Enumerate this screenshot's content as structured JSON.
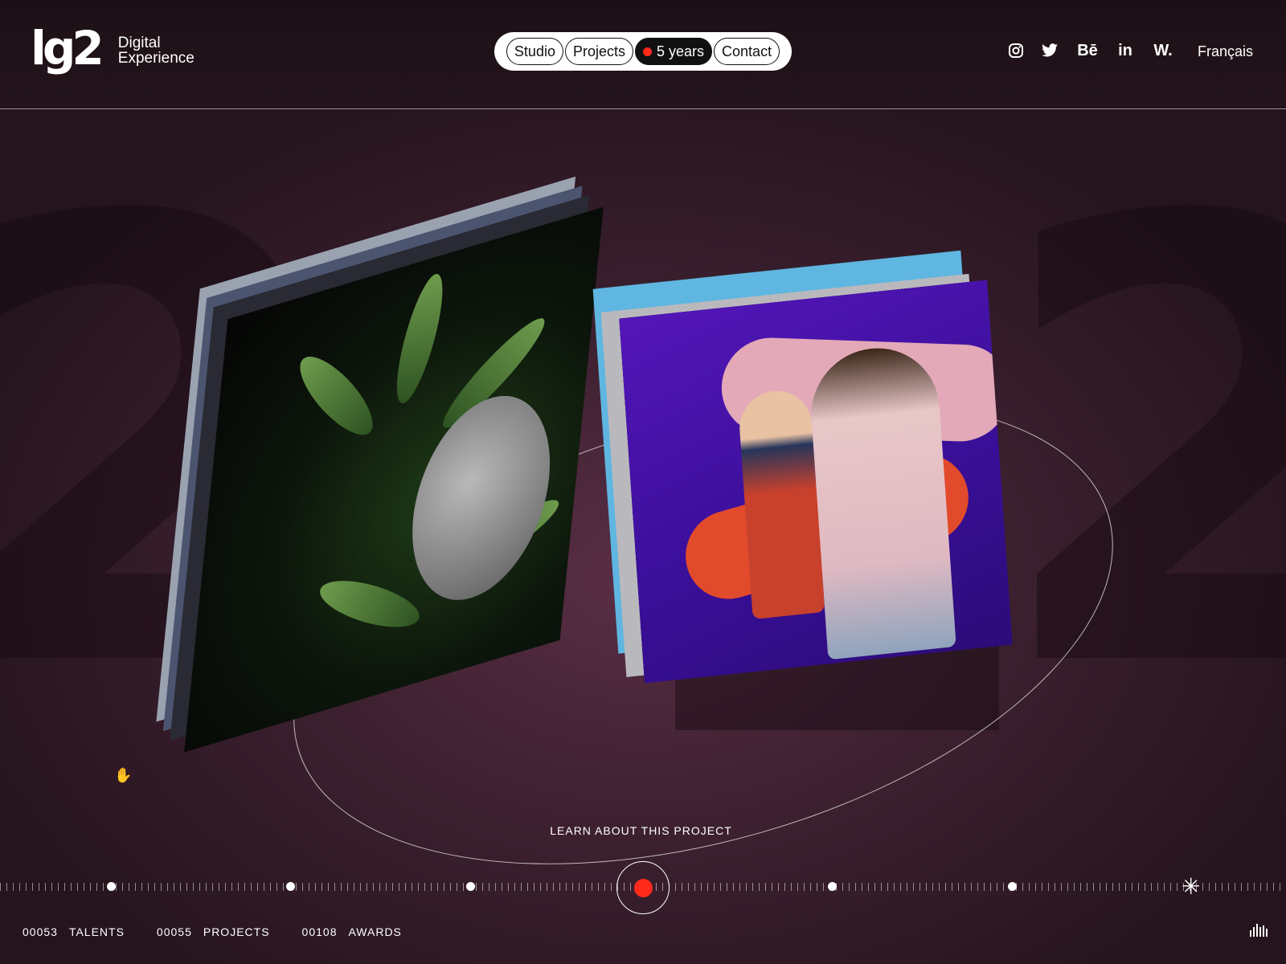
{
  "brand": {
    "logo": "lg2",
    "subtitle_line1": "Digital",
    "subtitle_line2": "Experience"
  },
  "nav": {
    "items": [
      {
        "label": "Studio"
      },
      {
        "label": "Projects"
      },
      {
        "label": "5 years"
      },
      {
        "label": "Contact"
      }
    ],
    "active": "5 years"
  },
  "social": {
    "behance": "Bē",
    "linkedin": "in",
    "wordpress": "W."
  },
  "language": "Français",
  "hero": {
    "background_digits": [
      "2",
      "2",
      "2"
    ],
    "cta": "LEARN ABOUT THIS PROJECT"
  },
  "stats": [
    {
      "count": "00053",
      "label": "TALENTS"
    },
    {
      "count": "00055",
      "label": "PROJECTS"
    },
    {
      "count": "00108",
      "label": "AWARDS"
    }
  ],
  "colors": {
    "accent": "#ff2a1a",
    "background": "#3e2131",
    "header": "#1c1016"
  },
  "icons": [
    "instagram-icon",
    "twitter-icon",
    "behance-icon",
    "linkedin-icon",
    "w-icon",
    "spark-icon",
    "sound-icon",
    "grab-cursor-icon"
  ]
}
